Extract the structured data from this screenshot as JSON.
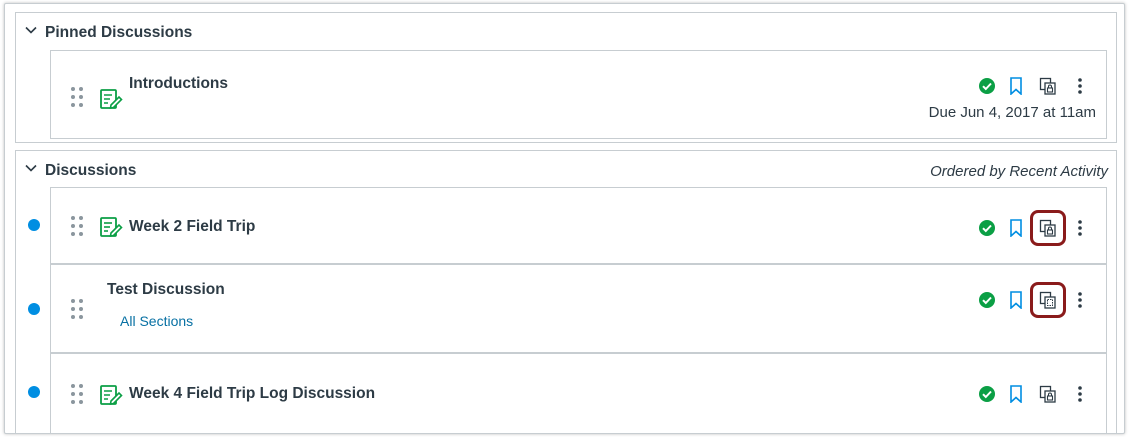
{
  "pinned": {
    "title": "Pinned Discussions",
    "items": [
      {
        "title": "Introductions",
        "due": "Due Jun 4, 2017 at 11am"
      }
    ]
  },
  "discussions": {
    "title": "Discussions",
    "ordered_label": "Ordered by Recent Activity",
    "items": [
      {
        "title": "Week 2 Field Trip"
      },
      {
        "title": "Test Discussion",
        "sections": "All Sections"
      },
      {
        "title": "Week 4 Field Trip Log Discussion"
      }
    ]
  },
  "colors": {
    "published": "#0b9f45",
    "bookmark": "#008ee2",
    "unread": "#008ee2",
    "highlight": "#8a1b1b",
    "link": "#0770a3"
  },
  "icons": {
    "toggle": "chevron-down-icon",
    "drag": "drag-handle-icon",
    "discussion": "discussion-icon",
    "published": "published-check-icon",
    "bookmark": "bookmark-icon",
    "copy_lock": "copy-lock-icon",
    "copy": "copy-icon",
    "more": "kebab-menu-icon"
  }
}
